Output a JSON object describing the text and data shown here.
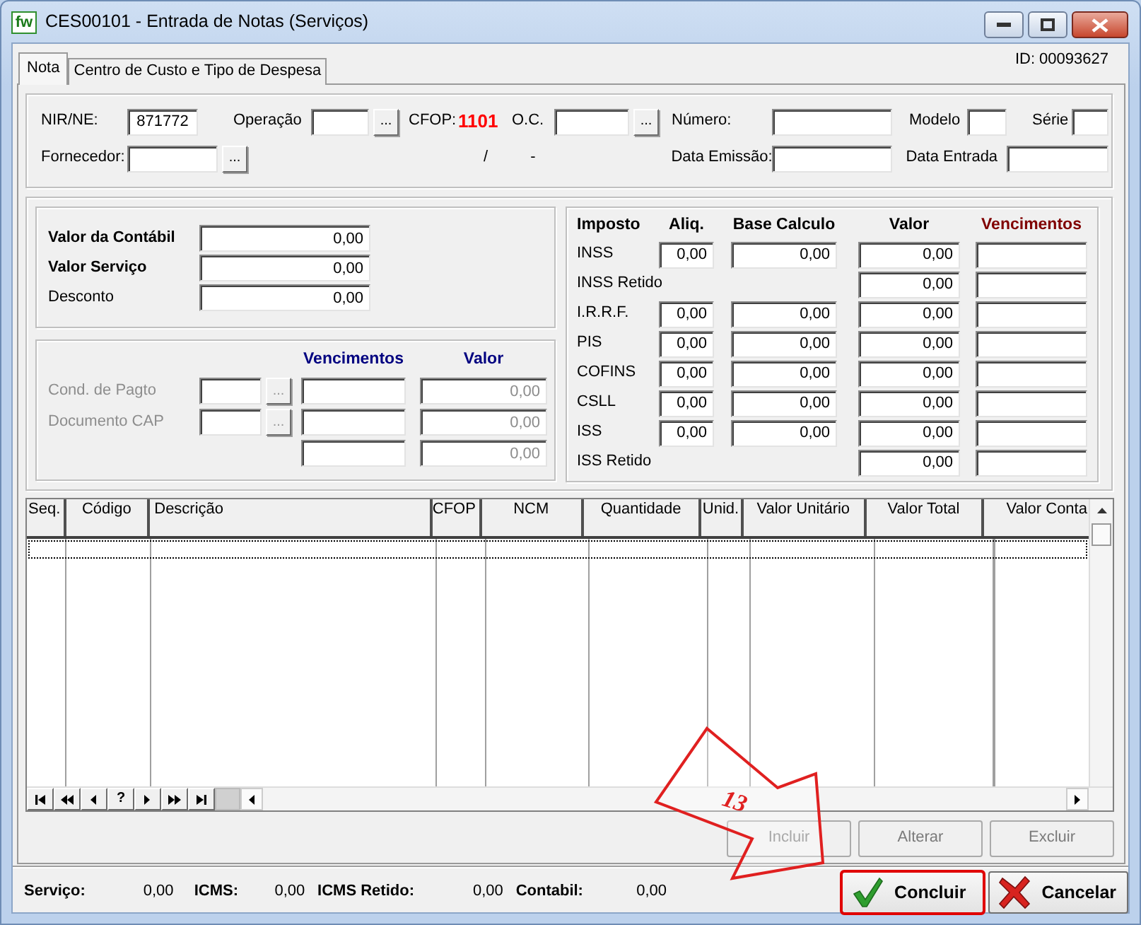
{
  "window": {
    "app_icon_text": "fw",
    "title": "CES00101 - Entrada de Notas (Serviços)"
  },
  "tabs": [
    {
      "label": "Nota",
      "selected": true
    },
    {
      "label": "Centro de Custo e Tipo de Despesa",
      "selected": false
    }
  ],
  "record_id": "ID: 00093627",
  "header_rows": [
    [
      {
        "kind": "field",
        "label": "NIR/NE:",
        "value": "871772"
      },
      {
        "kind": "field",
        "label": "Operação",
        "button": "..."
      },
      {
        "kind": "text",
        "label": "CFOP:",
        "value": "1101",
        "color": "#ff0000"
      },
      {
        "kind": "field",
        "label": "O.C.",
        "button": "..."
      },
      {
        "kind": "field",
        "label": "Número:"
      },
      {
        "kind": "field",
        "label": "Modelo"
      },
      {
        "kind": "field",
        "label": "Série"
      }
    ],
    [
      {
        "kind": "field",
        "label": "Fornecedor:",
        "button": "..."
      },
      {
        "kind": "text",
        "value": "/"
      },
      {
        "kind": "text",
        "value": "-"
      },
      {
        "kind": "field",
        "label": "Data Emissão:"
      },
      {
        "kind": "field",
        "label": "Data Entrada"
      }
    ]
  ],
  "valores": [
    {
      "label": "Valor da Contábil",
      "value": "0,00",
      "bold": true
    },
    {
      "label": "Valor Serviço",
      "value": "0,00",
      "bold": true
    },
    {
      "label": "Desconto",
      "value": "0,00",
      "bold": false
    }
  ],
  "pagamento": {
    "disabled": true,
    "headers": [
      {
        "label": "Vencimentos",
        "color": "#000080"
      },
      {
        "label": "Valor",
        "color": "#000080"
      }
    ],
    "rows": [
      {
        "label": "Cond. de Pagto",
        "button": "...",
        "valor": "0,00"
      },
      {
        "label": "Documento CAP",
        "button": "...",
        "valor": "0,00"
      },
      {
        "valor": "0,00"
      }
    ]
  },
  "impostos": {
    "headers": [
      {
        "label": "Imposto",
        "color": "#000000"
      },
      {
        "label": "Aliq.",
        "color": "#000000"
      },
      {
        "label": "Base Calculo",
        "color": "#000000"
      },
      {
        "label": "Valor",
        "color": "#000000"
      },
      {
        "label": "Vencimentos",
        "color": "#800000"
      }
    ],
    "rows": [
      {
        "label": "INSS",
        "aliq": "0,00",
        "base": "0,00",
        "valor": "0,00"
      },
      {
        "label": "INSS Retido",
        "valor": "0,00"
      },
      {
        "label": "I.R.R.F.",
        "aliq": "0,00",
        "base": "0,00",
        "valor": "0,00"
      },
      {
        "label": "PIS",
        "aliq": "0,00",
        "base": "0,00",
        "valor": "0,00"
      },
      {
        "label": "COFINS",
        "aliq": "0,00",
        "base": "0,00",
        "valor": "0,00"
      },
      {
        "label": "CSLL",
        "aliq": "0,00",
        "base": "0,00",
        "valor": "0,00"
      },
      {
        "label": "ISS",
        "aliq": "0,00",
        "base": "0,00",
        "valor": "0,00"
      },
      {
        "label": "ISS Retido",
        "valor": "0,00"
      }
    ]
  },
  "grid": {
    "columns": [
      "Seq.",
      "Código",
      "Descrição",
      "CFOP",
      "NCM",
      "Quantidade",
      "Unid.",
      "Valor Unitário",
      "Valor Total",
      "Valor Conta"
    ],
    "rows": [
      {
        "selected": true
      }
    ],
    "navigator": [
      {
        "kind": "first"
      },
      {
        "kind": "prev-page"
      },
      {
        "kind": "prev"
      },
      {
        "kind": "help",
        "label": "?"
      },
      {
        "kind": "next"
      },
      {
        "kind": "next-page"
      },
      {
        "kind": "last"
      }
    ]
  },
  "actions": [
    {
      "label": "Incluir",
      "disabled": true
    },
    {
      "label": "Alterar",
      "disabled": true
    },
    {
      "label": "Excluir",
      "disabled": true
    }
  ],
  "totals": [
    {
      "label": "Serviço:",
      "value": "0,00"
    },
    {
      "label": "ICMS:",
      "value": "0,00"
    },
    {
      "label": "ICMS Retido:",
      "value": "0,00"
    },
    {
      "label": "Contabil:",
      "value": "0,00"
    }
  ],
  "footer_buttons": [
    {
      "kind": "confirm",
      "label": "Concluir",
      "highlighted": true
    },
    {
      "kind": "cancel",
      "label": "Cancelar",
      "highlighted": false
    }
  ],
  "callout": {
    "number": "13"
  }
}
